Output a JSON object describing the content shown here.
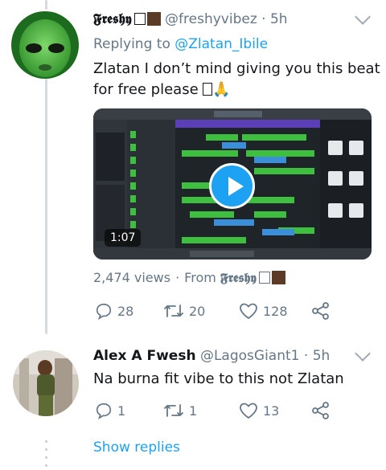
{
  "tweet": {
    "display_name": "𝕱𝖗𝖊𝖘𝖍𝖞",
    "handle": "@freshyvibez",
    "time": "5h",
    "replying_prefix": "Replying to",
    "replying_to": "@Zlatan_Ibile",
    "text_line1": "Zlatan I don’t mind giving you this beat",
    "text_line2": "for free please",
    "video_duration": "1:07",
    "views": "2,474 views",
    "from_prefix": "From",
    "from_name": "𝕱𝖗𝖊𝖘𝖍𝖞",
    "actions": {
      "replies": "28",
      "retweets": "20",
      "likes": "128"
    }
  },
  "reply": {
    "display_name": "Alex A Fwesh",
    "handle": "@LagosGiant1",
    "time": "5h",
    "text": "Na burna fit vibe to this not Zlatan",
    "actions": {
      "replies": "1",
      "retweets": "1",
      "likes": "13"
    }
  },
  "show_replies_label": "Show replies",
  "colors": {
    "accent": "#1da1f2",
    "secondary_text": "#657786",
    "daw_green": "#3fbf3f"
  },
  "icons": [
    "play-icon",
    "reply-icon",
    "retweet-icon",
    "like-icon",
    "share-icon",
    "chevron-down-icon"
  ]
}
